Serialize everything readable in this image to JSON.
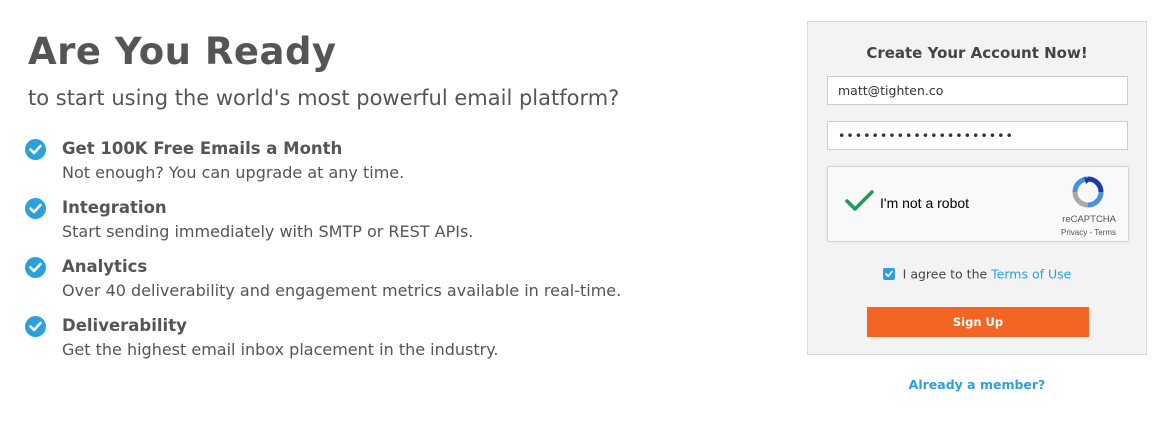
{
  "hero": {
    "headline": "Are You Ready",
    "subhead": "to start using the world's most powerful email platform?"
  },
  "features": [
    {
      "icon": "check-circle-icon",
      "title": "Get 100K Free Emails a Month",
      "description": "Not enough? You can upgrade at any time."
    },
    {
      "icon": "check-circle-icon",
      "title": "Integration",
      "description": "Start sending immediately with SMTP or REST APIs."
    },
    {
      "icon": "check-circle-icon",
      "title": "Analytics",
      "description": "Over 40 deliverability and engagement metrics available in real-time."
    },
    {
      "icon": "check-circle-icon",
      "title": "Deliverability",
      "description": "Get the highest email inbox placement in the industry."
    }
  ],
  "signup_form": {
    "title": "Create Your Account Now!",
    "email_value": "matt@tighten.co",
    "password_value": "•••••••••••••••••••••",
    "recaptcha": {
      "label": "I'm not a robot",
      "checked": true,
      "brand": "reCAPTCHA",
      "terms": "Privacy - Terms"
    },
    "agree": {
      "checked": true,
      "text": "I agree to the ",
      "link": "Terms of Use"
    },
    "submit_label": "Sign Up",
    "member_link": "Already a member?"
  },
  "colors": {
    "accent_blue": "#2aa1dc",
    "button_orange": "#f26522",
    "recaptcha_check_green": "#1f9d55"
  }
}
